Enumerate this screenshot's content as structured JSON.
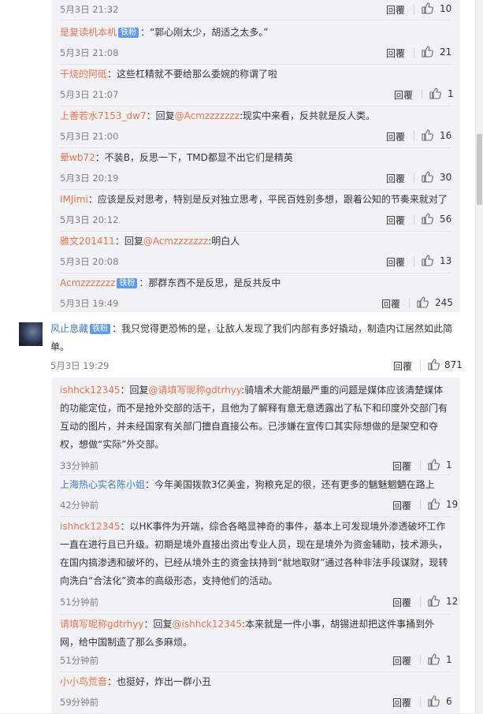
{
  "reply_label": "回覆",
  "badge_label": "铁粉",
  "top_time": "5月3日 21:32",
  "top_likes": "10",
  "replies_a": [
    {
      "user": "是复读机本机",
      "badge": true,
      "sep": "：",
      "text": "“郭心刚太少，胡适之太多。”",
      "time": "5月3日 21:08",
      "likes": "21"
    },
    {
      "user": "干烧的阿砥",
      "badge": false,
      "sep": "：",
      "text": "这些杠精就不要给那么委婉的称谓了啦",
      "time": "5月3日 21:07",
      "likes": "1"
    },
    {
      "user": "上善若水7153_dw7",
      "badge": false,
      "sep": "：回复",
      "mention": "@Acmzzzzzzz",
      "text": ":现实中来看，反共就是反人类。",
      "time": "5月3日 21:00",
      "likes": "16"
    },
    {
      "user": "晕wb72",
      "badge": false,
      "sep": "：",
      "text": "不装B，反思一下，TMD都显不出它们是精英",
      "time": "5月3日 20:19",
      "likes": "30"
    },
    {
      "user": "IMJimi",
      "badge": false,
      "sep": "：",
      "text": "应该是反对思考，特别是反对独立思考，平民百姓别多想，跟着公知的节奏来就对了",
      "time": "5月3日 20:12",
      "likes": "56"
    },
    {
      "user": "雅文201411",
      "badge": false,
      "sep": "：回复",
      "mention": "@Acmzzzzzzz",
      "text": ":明白人",
      "time": "5月3日 20:08",
      "likes": "13"
    },
    {
      "user": "Acmzzzzzzz",
      "badge": true,
      "sep": "：",
      "text": "那群东西不是反思，是反共反中",
      "time": "5月3日 19:49",
      "likes": "245"
    }
  ],
  "main": {
    "user": "风止息藏",
    "badge": true,
    "sep": "：",
    "text": "我只觉得更恐怖的是，让敌人发现了我们内部有多好撬动，制造内讧居然如此简单。",
    "time": "5月3日 19:29",
    "likes": "871"
  },
  "replies_b": [
    {
      "user": "ishhck12345",
      "badge": false,
      "sep": "：回复",
      "mention": "@请填写昵称gdtrhyy",
      "text": ":骑墙术大能胡最严重的问题是媒体应该清楚媒体的功能定位，而不是抢外交部的活干，且他为了解释有意无意透露出了私下和印度外交部门有互动的图片，并未经国家有关部门擅自直接公布。已涉嫌在宣传口其实际想做的是架空和夺权，想做“实际”外交部。",
      "time": "33分钟前",
      "likes": "1"
    },
    {
      "user": "上海热心实名陈小姐",
      "badge": false,
      "sep": "：",
      "text": "今年美国拨款3亿美金，狗粮充足的很，还有更多的魑魅魍魉在路上",
      "time": "42分钟前",
      "likes": "19"
    },
    {
      "user": "ishhck12345",
      "badge": false,
      "sep": "：",
      "text": "以HK事件为开端，综合各略显神奇的事件，基本上可发现境外渗透破坏工作一直在进行且已升级。初期是境外直接出资出专业人员，现在是境外为资金辅助，技术源头，在国内搞渗透和破坏的，已经从境外主的资金扶持到“就地取财”通过各种非法手段谋财，现转向洗白“合法化”资本的高级形态，支持他们的活动。",
      "time": "51分钟前",
      "likes": "12"
    },
    {
      "user": "请填写昵称gdtrhyy",
      "badge": false,
      "sep": "：回复",
      "mention": "@ishhck12345",
      "text": ":本来就是一件小事，胡锡进却把这件事捅到外网，给中国制造了那么多麻烦。",
      "time": "51分钟前",
      "likes": "1"
    },
    {
      "user": "小小鸟荒音",
      "badge": false,
      "sep": "：",
      "text": "也挺好，炸出一群小丑",
      "time": "59分钟前",
      "likes": "6"
    }
  ]
}
